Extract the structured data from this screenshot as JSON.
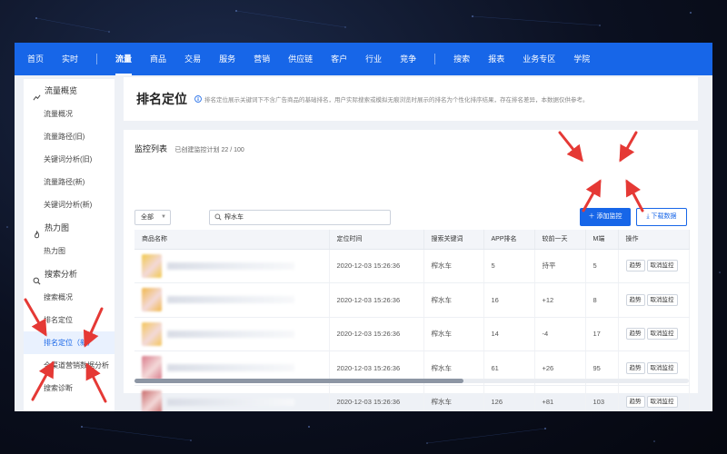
{
  "topnav": {
    "items": [
      "首页",
      "实时",
      "流量",
      "商品",
      "交易",
      "服务",
      "营销",
      "供应链",
      "客户",
      "行业",
      "竞争",
      "搜索",
      "报表",
      "业务专区",
      "学院"
    ],
    "active_index": 2
  },
  "sidebar": {
    "groups": [
      {
        "label": "流量概览",
        "icon": "chart-bars-icon",
        "items": [
          "流量概况",
          "流量路径(旧)",
          "关键词分析(旧)",
          "流量路径(新)",
          "关键词分析(新)"
        ]
      },
      {
        "label": "热力图",
        "icon": "flame-icon",
        "items": [
          "热力图"
        ]
      },
      {
        "label": "搜索分析",
        "icon": "search-icon",
        "items": [
          "搜索概况",
          "排名定位",
          "排名定位（新）",
          "全渠道营销数据分析",
          "搜索诊断"
        ]
      }
    ],
    "active_item": "排名定位（新）"
  },
  "header": {
    "title": "排名定位",
    "description": "排名定位展示关键词下不含广告商品的基础排名，用户实际搜索或模拟无痕浏览时展示的排名为个性化排序结果，存在排名差异，本数据仅供参考。"
  },
  "list": {
    "title": "监控列表",
    "count_label": "已创建监控计划",
    "count_value": "22 / 100",
    "filter_value": "全部",
    "search_value": "榨水车",
    "add_button": "添加监控",
    "download_button": "下载数据",
    "columns": [
      "商品名称",
      "定位时间",
      "搜索关键词",
      "APP排名",
      "较前一天",
      "M端",
      "操作"
    ],
    "rows": [
      {
        "time": "2020-12-03 15:26:36",
        "keyword": "榨水车",
        "app_rank": "5",
        "change": "持平",
        "change_dir": "flat",
        "m_rank": "5",
        "thumb": "#f2c94c"
      },
      {
        "time": "2020-12-03 15:26:36",
        "keyword": "榨水车",
        "app_rank": "16",
        "change": "+12",
        "change_dir": "up",
        "m_rank": "8",
        "thumb": "#f2b84b"
      },
      {
        "time": "2020-12-03 15:26:36",
        "keyword": "榨水车",
        "app_rank": "14",
        "change": "-4",
        "change_dir": "down",
        "m_rank": "17",
        "thumb": "#f4c65a"
      },
      {
        "time": "2020-12-03 15:26:36",
        "keyword": "榨水车",
        "app_rank": "61",
        "change": "+26",
        "change_dir": "up",
        "m_rank": "95",
        "thumb": "#d97b8a"
      },
      {
        "time": "2020-12-03 15:26:36",
        "keyword": "榨水车",
        "app_rank": "126",
        "change": "+81",
        "change_dir": "up",
        "m_rank": "103",
        "thumb": "#c96a6a"
      }
    ],
    "row_actions": [
      "趋势",
      "取消监控"
    ]
  },
  "colors": {
    "primary": "#1766e8",
    "annotation_arrow": "#e53935",
    "up": "#e8423f",
    "down": "#3aa84b"
  }
}
